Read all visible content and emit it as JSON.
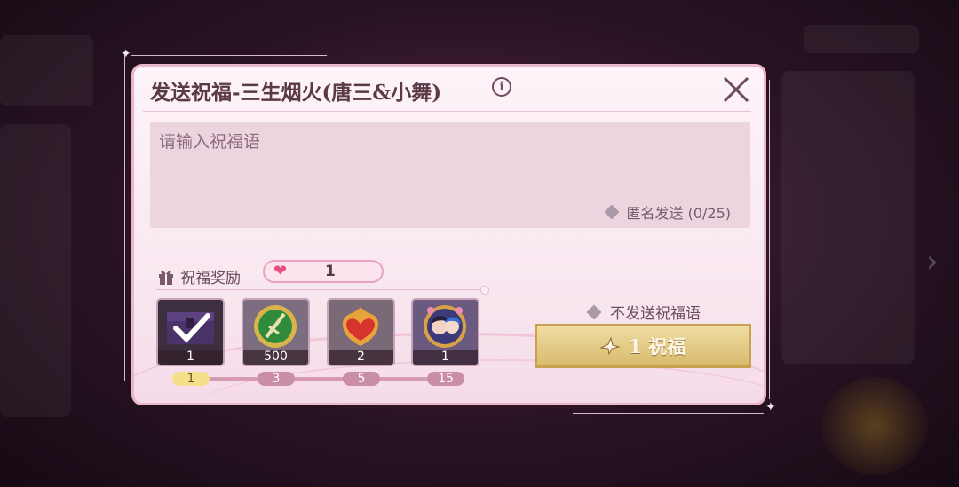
{
  "dialog": {
    "title": "发送祝福-三生烟火(唐三&小舞)",
    "input_placeholder": "请输入祝福语",
    "anonymous_label": "匿名发送 (0/25)",
    "reward_label": "祝福奖励",
    "heart_count": "1",
    "no_message_label": "不发送祝福语",
    "bless_button_label": "1 祝福"
  },
  "rewards": [
    {
      "icon": "chest-icon",
      "count": "1",
      "claimed": true
    },
    {
      "icon": "sword-badge-icon",
      "count": "500",
      "claimed": false
    },
    {
      "icon": "flame-heart-icon",
      "count": "2",
      "claimed": false
    },
    {
      "icon": "couple-avatar-icon",
      "count": "1",
      "claimed": false
    }
  ],
  "milestones": [
    "1",
    "3",
    "5",
    "15"
  ],
  "colors": {
    "accent": "#e7507f",
    "gold": "#d9bb6d",
    "panel": "#fdf3f8"
  }
}
